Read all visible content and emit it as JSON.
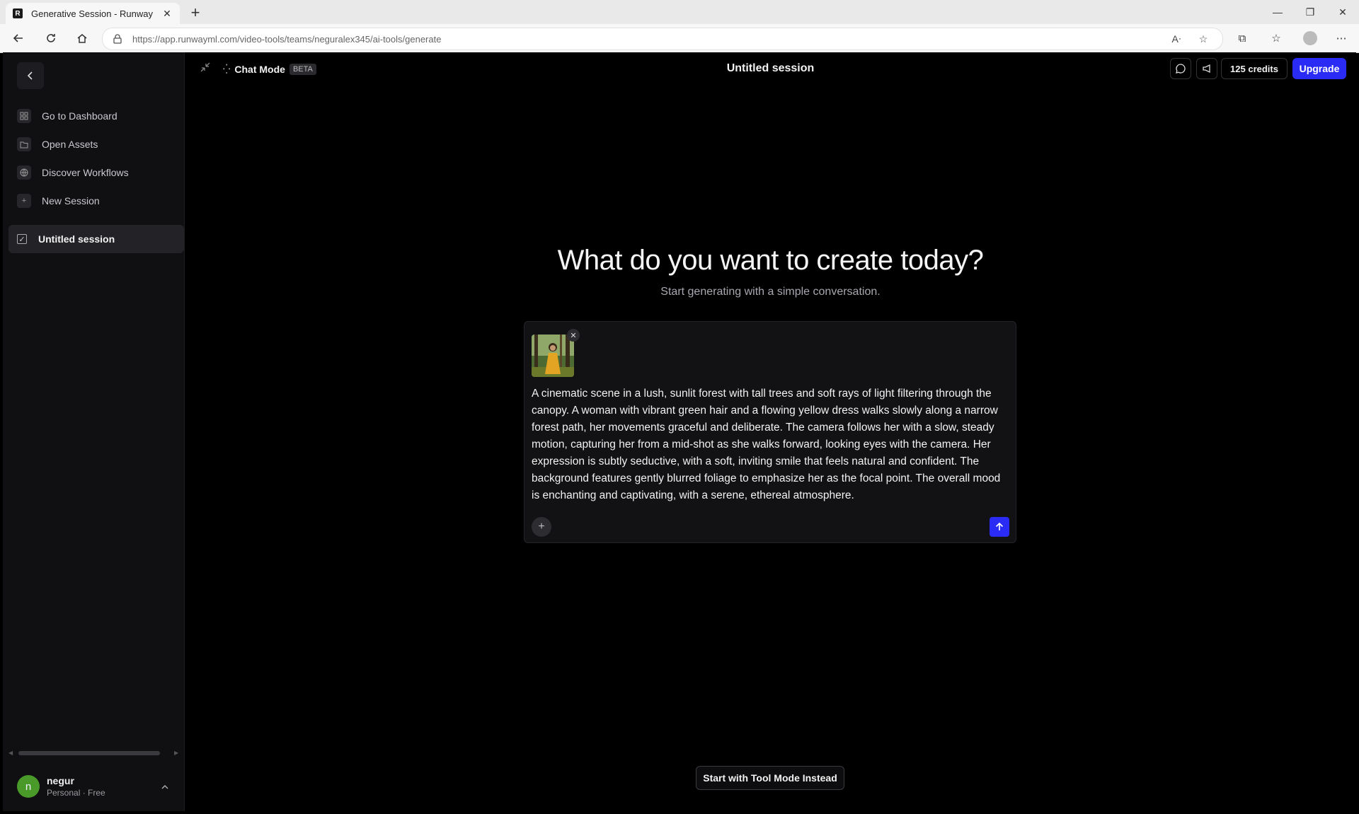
{
  "browser": {
    "tab_title": "Generative Session - Runway",
    "tab_favicon_letter": "R",
    "url": "https://app.runwayml.com/video-tools/teams/neguralex345/ai-tools/generate"
  },
  "sidebar": {
    "nav_items": [
      {
        "label": "Go to Dashboard",
        "icon": "grid-icon"
      },
      {
        "label": "Open Assets",
        "icon": "folder-icon"
      },
      {
        "label": "Discover Workflows",
        "icon": "globe-icon"
      },
      {
        "label": "New Session",
        "icon": "plus-icon"
      }
    ],
    "session": {
      "label": "Untitled session"
    },
    "user": {
      "initial": "n",
      "name": "negur",
      "plan": "Personal · Free",
      "avatar_color": "#4a9a2a"
    }
  },
  "header": {
    "chat_mode_label": "Chat Mode",
    "beta_badge": "BETA",
    "session_title": "Untitled session",
    "credits_label": "125 credits",
    "upgrade_label": "Upgrade"
  },
  "hero": {
    "title": "What do you want to create today?",
    "subtitle": "Start generating with a simple conversation."
  },
  "composer": {
    "prompt": "A cinematic scene in a lush, sunlit forest with tall trees and soft rays of light filtering through the canopy. A woman with vibrant green hair and a flowing yellow dress walks slowly along a narrow forest path, her movements graceful and deliberate. The camera follows her with a slow, steady motion, capturing her from a mid-shot as she walks forward, looking eyes with the camera. Her expression is subtly seductive, with a soft, inviting smile that feels natural and confident. The background features gently blurred foliage to emphasize her as the focal point. The overall mood is enchanting and captivating, with a serene, ethereal atmosphere."
  },
  "footer": {
    "tool_mode_label": "Start with Tool Mode Instead"
  },
  "colors": {
    "accent": "#2a2cf6",
    "background": "#000000",
    "sidebar": "#101012"
  }
}
